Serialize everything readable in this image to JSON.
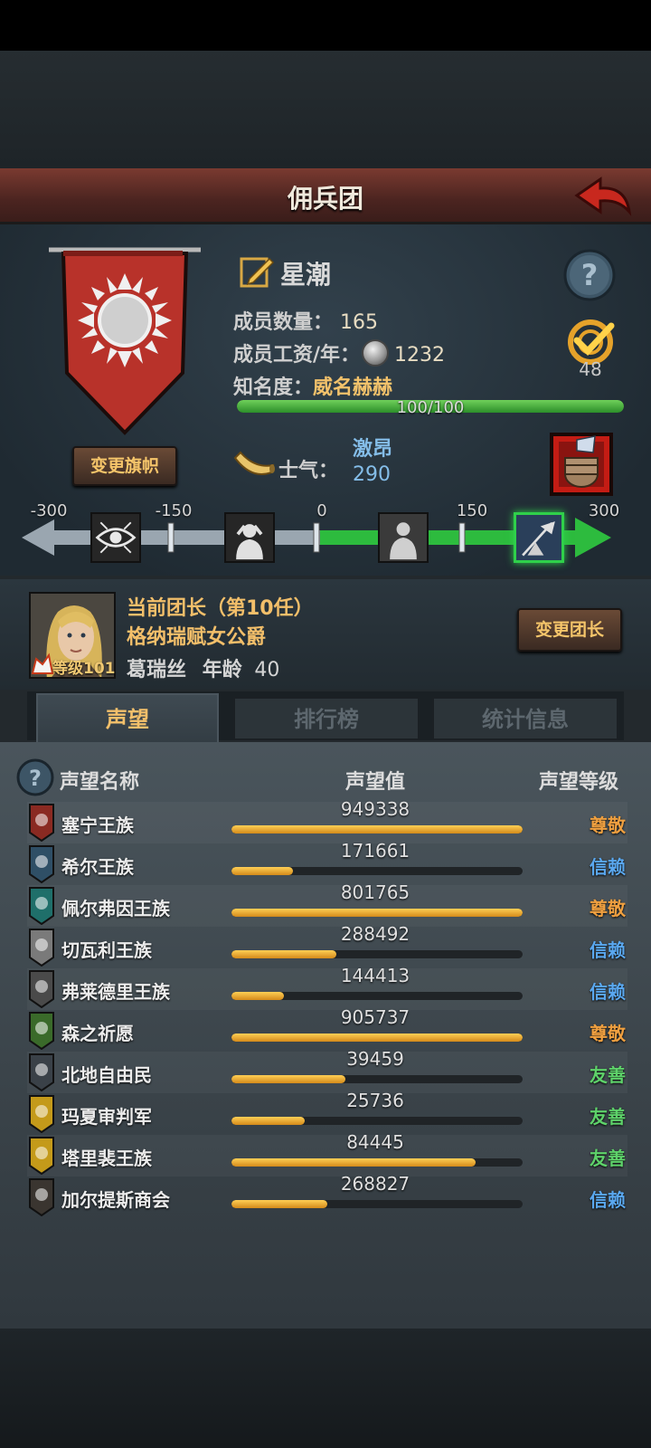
{
  "header": {
    "title": "佣兵团"
  },
  "guild": {
    "name": "星潮",
    "member_count_label": "成员数量：",
    "member_count": "165",
    "salary_label": "成员工资/年：",
    "salary": "1232",
    "fame_label": "知名度：",
    "fame_state": "威名赫赫",
    "fame_progress_text": "100/100",
    "fame_progress": 1.0,
    "target_count": "48",
    "change_flag_label": "变更旗帜",
    "colors": {
      "banner": "#b8322a",
      "fame_bar": "#3fb43a",
      "accent": "#f3bf6a"
    }
  },
  "morale": {
    "label": "士气：",
    "state": "激昂",
    "value": "290",
    "ticks": [
      "-300",
      "-150",
      "0",
      "150",
      "300"
    ],
    "icons": [
      "evil-eye-icon",
      "despair-figure-icon",
      "calm-figure-icon",
      "charge-flag-icon"
    ],
    "active_level_index": 3
  },
  "leader": {
    "title_line": "当前团长（第10任）",
    "rank_line": "格纳瑞赋女公爵",
    "name": "葛瑞丝",
    "age_label": "年龄",
    "age": "40",
    "level_label": "等级101",
    "change_leader_label": "变更团长"
  },
  "tabs": [
    {
      "label": "声望",
      "active": true
    },
    {
      "label": "排行榜",
      "active": false
    },
    {
      "label": "统计信息",
      "active": false
    }
  ],
  "reputation": {
    "col_name": "声望名称",
    "col_value": "声望值",
    "col_level": "声望等级",
    "level_colors": {
      "尊敬": "#f0a040",
      "信赖": "#5aa8f0",
      "友善": "#5ed26a"
    },
    "rows": [
      {
        "name": "塞宁王族",
        "value": "949338",
        "fill": 1.0,
        "level": "尊敬",
        "icon": "red-tree-crest-icon",
        "icon_color": "#8a2a22"
      },
      {
        "name": "希尔王族",
        "value": "171661",
        "fill": 0.21,
        "level": "信赖",
        "icon": "blue-helm-crest-icon",
        "icon_color": "#2f4f66"
      },
      {
        "name": "佩尔弗因王族",
        "value": "801765",
        "fill": 1.0,
        "level": "尊敬",
        "icon": "teal-castle-crest-icon",
        "icon_color": "#1f6f6a"
      },
      {
        "name": "切瓦利王族",
        "value": "288492",
        "fill": 0.36,
        "level": "信赖",
        "icon": "scales-crest-icon",
        "icon_color": "#7a7a7a"
      },
      {
        "name": "弗莱德里王族",
        "value": "144413",
        "fill": 0.18,
        "level": "信赖",
        "icon": "skull-crest-icon",
        "icon_color": "#4a4a4a"
      },
      {
        "name": "森之祈愿",
        "value": "905737",
        "fill": 1.0,
        "level": "尊敬",
        "icon": "green-tree-crest-icon",
        "icon_color": "#3a6a2a"
      },
      {
        "name": "北地自由民",
        "value": "39459",
        "fill": 0.39,
        "level": "友善",
        "icon": "axe-crest-icon",
        "icon_color": "#3a4148"
      },
      {
        "name": "玛夏审判军",
        "value": "25736",
        "fill": 0.25,
        "level": "友善",
        "icon": "gold-cross-crest-icon",
        "icon_color": "#c49a1a"
      },
      {
        "name": "塔里裴王族",
        "value": "84445",
        "fill": 0.84,
        "level": "友善",
        "icon": "gold-crown-crest-icon",
        "icon_color": "#c49a1a"
      },
      {
        "name": "加尔提斯商会",
        "value": "268827",
        "fill": 0.33,
        "level": "信赖",
        "icon": "chest-crest-icon",
        "icon_color": "#3a3530"
      }
    ]
  }
}
